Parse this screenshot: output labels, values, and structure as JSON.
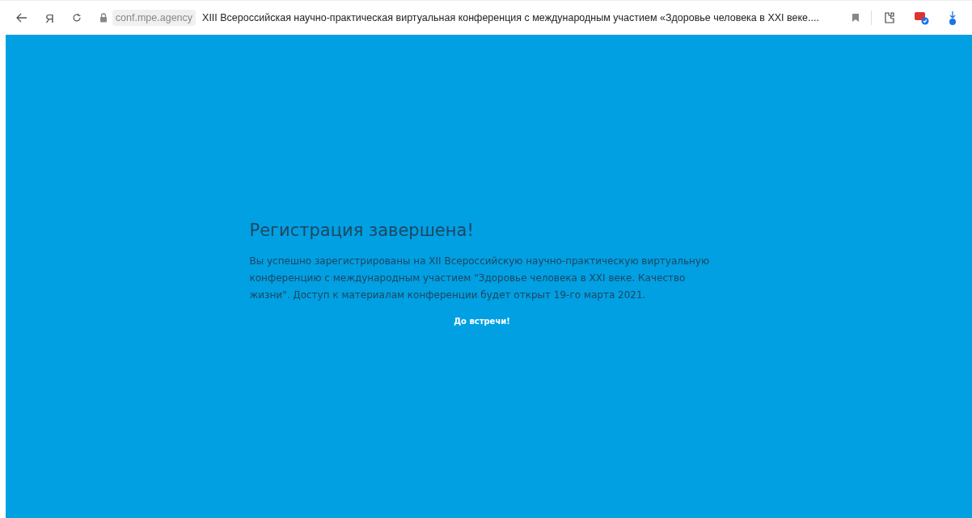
{
  "browser": {
    "logo": "Я",
    "domain": "conf.mpe.agency",
    "title": "XIII Всероссийская научно-практическая виртуальная конференция с международным участием «Здоровье человека в XXI веке...."
  },
  "page": {
    "heading": "Регистрация завершена!",
    "message": "Вы успешно зарегистрированы на XII Всероссийскую научно-практическую виртуальную конференцию с международным участием \"Здоровье человека в XXI веке. Качество жизни\". Доступ к материалам конференции будет открыт 19-го марта 2021.",
    "farewell": "До встречи!"
  }
}
